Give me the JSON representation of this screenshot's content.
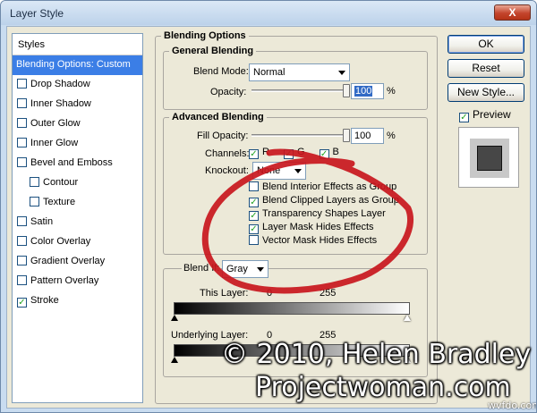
{
  "window": {
    "title": "Layer Style",
    "close_glyph": "X"
  },
  "styles_list": {
    "header": "Styles",
    "items": [
      {
        "label": "Blending Options: Custom",
        "selected": true,
        "checkbox": false,
        "checked": false,
        "indent": false
      },
      {
        "label": "Drop Shadow",
        "checkbox": true,
        "checked": false,
        "indent": false
      },
      {
        "label": "Inner Shadow",
        "checkbox": true,
        "checked": false,
        "indent": false
      },
      {
        "label": "Outer Glow",
        "checkbox": true,
        "checked": false,
        "indent": false
      },
      {
        "label": "Inner Glow",
        "checkbox": true,
        "checked": false,
        "indent": false
      },
      {
        "label": "Bevel and Emboss",
        "checkbox": true,
        "checked": false,
        "indent": false
      },
      {
        "label": "Contour",
        "checkbox": true,
        "checked": false,
        "indent": true
      },
      {
        "label": "Texture",
        "checkbox": true,
        "checked": false,
        "indent": true
      },
      {
        "label": "Satin",
        "checkbox": true,
        "checked": false,
        "indent": false
      },
      {
        "label": "Color Overlay",
        "checkbox": true,
        "checked": false,
        "indent": false
      },
      {
        "label": "Gradient Overlay",
        "checkbox": true,
        "checked": false,
        "indent": false
      },
      {
        "label": "Pattern Overlay",
        "checkbox": true,
        "checked": false,
        "indent": false
      },
      {
        "label": "Stroke",
        "checkbox": true,
        "checked": true,
        "indent": false
      }
    ]
  },
  "blending": {
    "title": "Blending Options",
    "general": {
      "title": "General Blending",
      "blend_mode_label": "Blend Mode:",
      "blend_mode_value": "Normal",
      "opacity_label": "Opacity:",
      "opacity_value": "100",
      "opacity_unit": "%",
      "opacity_level": 1.0
    },
    "advanced": {
      "title": "Advanced Blending",
      "fill_opacity_label": "Fill Opacity:",
      "fill_opacity_value": "100",
      "fill_opacity_unit": "%",
      "fill_opacity_level": 1.0,
      "channels_label": "Channels:",
      "channels": [
        {
          "label": "R",
          "checked": true
        },
        {
          "label": "G",
          "checked": true
        },
        {
          "label": "B",
          "checked": true
        }
      ],
      "knockout_label": "Knockout:",
      "knockout_value": "None",
      "options": [
        {
          "label": "Blend Interior Effects as Group",
          "checked": false
        },
        {
          "label": "Blend Clipped Layers as Group",
          "checked": true
        },
        {
          "label": "Transparency Shapes Layer",
          "checked": true
        },
        {
          "label": "Layer Mask Hides Effects",
          "checked": true
        },
        {
          "label": "Vector Mask Hides Effects",
          "checked": false
        }
      ]
    },
    "blend_if": {
      "label": "Blend If:",
      "value": "Gray",
      "this_layer_label": "This Layer:",
      "this_layer_min": "0",
      "this_layer_max": "255",
      "underlying_label": "Underlying Layer:",
      "underlying_min": "0",
      "underlying_max": "255"
    }
  },
  "buttons": {
    "ok": "OK",
    "reset": "Reset",
    "new_style": "New Style..."
  },
  "preview": {
    "label": "Preview",
    "checked": true
  },
  "watermark": {
    "line1": "© 2010, Helen Bradley",
    "line2": "Projectwoman.com",
    "site": "wvfdo.com"
  },
  "colors": {
    "selection": "#3b7ee6",
    "annotation": "#c8161d",
    "dialog_bg": "#ece9d8",
    "title_bar": "#c9dcf0",
    "close_button": "#c4452c"
  }
}
